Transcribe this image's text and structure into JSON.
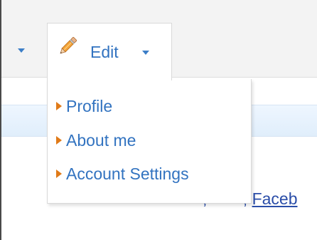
{
  "nav": {
    "edit_tab": {
      "label": "Edit",
      "icon": "pencil-icon"
    }
  },
  "dropdown": {
    "items": [
      {
        "label": "Profile"
      },
      {
        "label": "About me"
      },
      {
        "label": "Account Settings"
      }
    ]
  },
  "background_links": {
    "separator_1": ",",
    "link_1": "",
    "separator_2": ",",
    "link_2": "Faceb"
  },
  "colors": {
    "link_blue": "#3273c0",
    "bullet_orange": "#e07a18",
    "pencil_orange": "#f2a33a"
  }
}
